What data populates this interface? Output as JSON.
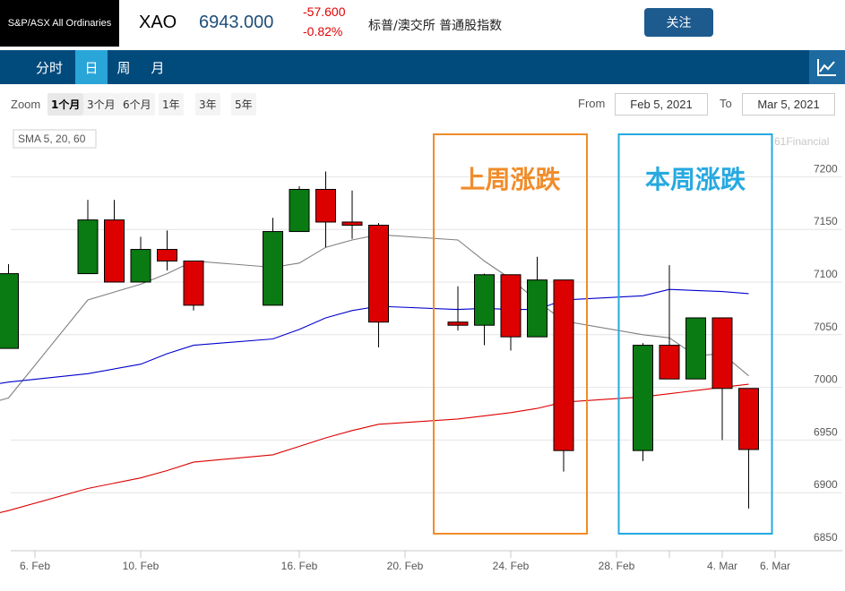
{
  "header": {
    "index_name": "S&P/ASX All Ordinaries",
    "symbol": "XAO",
    "price": "6943.000",
    "change_abs": "-57.600",
    "change_pct": "-0.82%",
    "description": "标普/澳交所 普通股指数",
    "follow_label": "关注"
  },
  "toolbar": {
    "tabs": [
      {
        "label": "分时",
        "active": false
      },
      {
        "label": "日",
        "active": true
      },
      {
        "label": "周",
        "active": false
      },
      {
        "label": "月",
        "active": false
      }
    ],
    "chart_icon": "line-chart-icon"
  },
  "controls": {
    "zoom_label": "Zoom",
    "zoom_options": [
      {
        "label": "1个月",
        "active": true
      },
      {
        "label": "3个月",
        "active": false
      },
      {
        "label": "6个月",
        "active": false
      },
      {
        "label": "1年",
        "active": false
      },
      {
        "label": "3年",
        "active": false
      },
      {
        "label": "5年",
        "active": false
      }
    ],
    "from_label": "From",
    "from_value": "Feb 5, 2021",
    "to_label": "To",
    "to_value": "Mar 5, 2021"
  },
  "chart_data": {
    "type": "candlestick",
    "indicator_label": "SMA 5, 20, 60",
    "watermark": "61Financial",
    "ylim": [
      6850,
      7225
    ],
    "y_ticks": [
      6850,
      6900,
      6950,
      7000,
      7050,
      7100,
      7150,
      7200
    ],
    "x_ticks": [
      {
        "date": "2021-02-06",
        "label": "6. Feb"
      },
      {
        "date": "2021-02-10",
        "label": "10. Feb"
      },
      {
        "date": "2021-02-16",
        "label": "16. Feb"
      },
      {
        "date": "2021-02-20",
        "label": "20. Feb"
      },
      {
        "date": "2021-02-24",
        "label": "24. Feb"
      },
      {
        "date": "2021-02-28",
        "label": "28. Feb"
      },
      {
        "date": "2021-03-02",
        "label": ""
      },
      {
        "date": "2021-03-04",
        "label": "4. Mar"
      },
      {
        "date": "2021-03-06",
        "label": "6. Mar"
      }
    ],
    "candles": [
      {
        "date": "2021-02-05",
        "open": 7037,
        "high": 7117,
        "low": 7037,
        "close": 7108
      },
      {
        "date": "2021-02-08",
        "open": 7108,
        "high": 7178,
        "low": 7108,
        "close": 7159
      },
      {
        "date": "2021-02-09",
        "open": 7159,
        "high": 7178,
        "low": 7100,
        "close": 7100
      },
      {
        "date": "2021-02-10",
        "open": 7100,
        "high": 7143,
        "low": 7100,
        "close": 7131
      },
      {
        "date": "2021-02-11",
        "open": 7131,
        "high": 7149,
        "low": 7111,
        "close": 7120
      },
      {
        "date": "2021-02-12",
        "open": 7120,
        "high": 7120,
        "low": 7073,
        "close": 7078
      },
      {
        "date": "2021-02-15",
        "open": 7078,
        "high": 7161,
        "low": 7078,
        "close": 7148
      },
      {
        "date": "2021-02-16",
        "open": 7148,
        "high": 7191,
        "low": 7148,
        "close": 7188
      },
      {
        "date": "2021-02-17",
        "open": 7188,
        "high": 7205,
        "low": 7133,
        "close": 7157
      },
      {
        "date": "2021-02-18",
        "open": 7157,
        "high": 7187,
        "low": 7141,
        "close": 7154
      },
      {
        "date": "2021-02-19",
        "open": 7154,
        "high": 7156,
        "low": 7038,
        "close": 7062
      },
      {
        "date": "2021-02-22",
        "open": 7062,
        "high": 7096,
        "low": 7054,
        "close": 7059
      },
      {
        "date": "2021-02-23",
        "open": 7059,
        "high": 7108,
        "low": 7040,
        "close": 7107
      },
      {
        "date": "2021-02-24",
        "open": 7107,
        "high": 7107,
        "low": 7035,
        "close": 7048
      },
      {
        "date": "2021-02-25",
        "open": 7048,
        "high": 7124,
        "low": 7048,
        "close": 7102
      },
      {
        "date": "2021-02-26",
        "open": 7102,
        "high": 7102,
        "low": 6920,
        "close": 6940
      },
      {
        "date": "2021-03-01",
        "open": 6940,
        "high": 7042,
        "low": 6930,
        "close": 7040
      },
      {
        "date": "2021-03-02",
        "open": 7040,
        "high": 7116,
        "low": 7008,
        "close": 7008
      },
      {
        "date": "2021-03-03",
        "open": 7008,
        "high": 7066,
        "low": 7008,
        "close": 7066
      },
      {
        "date": "2021-03-04",
        "open": 7066,
        "high": 7066,
        "low": 6950,
        "close": 6999
      },
      {
        "date": "2021-03-05",
        "open": 6999,
        "high": 6999,
        "low": 6885,
        "close": 6941
      }
    ],
    "series": [
      {
        "color": "#808080",
        "points": [
          [
            "2021-02-04",
            6983
          ],
          [
            "2021-02-05",
            6990
          ],
          [
            "2021-02-08",
            7083
          ],
          [
            "2021-02-10",
            7098
          ],
          [
            "2021-02-11",
            7108
          ],
          [
            "2021-02-12",
            7120
          ],
          [
            "2021-02-15",
            7114
          ],
          [
            "2021-02-16",
            7118
          ],
          [
            "2021-02-17",
            7133
          ],
          [
            "2021-02-18",
            7140
          ],
          [
            "2021-02-19",
            7145
          ],
          [
            "2021-02-22",
            7140
          ],
          [
            "2021-02-23",
            7120
          ],
          [
            "2021-02-24",
            7103
          ],
          [
            "2021-02-25",
            7082
          ],
          [
            "2021-02-26",
            7063
          ],
          [
            "2021-03-01",
            7050
          ],
          [
            "2021-03-02",
            7047
          ],
          [
            "2021-03-03",
            7030
          ],
          [
            "2021-03-04",
            7032
          ],
          [
            "2021-03-05",
            7011
          ]
        ]
      },
      {
        "color": "#0000cc",
        "points": [
          [
            "2021-02-04",
            7001
          ],
          [
            "2021-02-05",
            7005
          ],
          [
            "2021-02-08",
            7013
          ],
          [
            "2021-02-10",
            7022
          ],
          [
            "2021-02-11",
            7032
          ],
          [
            "2021-02-12",
            7040
          ],
          [
            "2021-02-15",
            7046
          ],
          [
            "2021-02-16",
            7055
          ],
          [
            "2021-02-17",
            7066
          ],
          [
            "2021-02-18",
            7073
          ],
          [
            "2021-02-19",
            7077
          ],
          [
            "2021-02-22",
            7074
          ],
          [
            "2021-02-23",
            7075
          ],
          [
            "2021-02-24",
            7074
          ],
          [
            "2021-02-25",
            7074
          ],
          [
            "2021-02-26",
            7083
          ],
          [
            "2021-03-01",
            7087
          ],
          [
            "2021-03-02",
            7093
          ],
          [
            "2021-03-03",
            7092
          ],
          [
            "2021-03-04",
            7091
          ],
          [
            "2021-03-05",
            7089
          ]
        ]
      },
      {
        "color": "#dd0000",
        "points": [
          [
            "2021-02-04",
            6877
          ],
          [
            "2021-02-05",
            6883
          ],
          [
            "2021-02-08",
            6904
          ],
          [
            "2021-02-10",
            6914
          ],
          [
            "2021-02-11",
            6921
          ],
          [
            "2021-02-12",
            6929
          ],
          [
            "2021-02-15",
            6936
          ],
          [
            "2021-02-16",
            6944
          ],
          [
            "2021-02-17",
            6952
          ],
          [
            "2021-02-18",
            6959
          ],
          [
            "2021-02-19",
            6965
          ],
          [
            "2021-02-22",
            6970
          ],
          [
            "2021-02-23",
            6973
          ],
          [
            "2021-02-24",
            6976
          ],
          [
            "2021-02-25",
            6980
          ],
          [
            "2021-02-26",
            6986
          ],
          [
            "2021-03-01",
            6991
          ],
          [
            "2021-03-02",
            6994
          ],
          [
            "2021-03-03",
            6997
          ],
          [
            "2021-03-04",
            7000
          ],
          [
            "2021-03-05",
            7003
          ]
        ]
      }
    ],
    "annotations": [
      {
        "label": "上周涨跌",
        "color": "#f08c2a",
        "from": "2021-02-22",
        "to": "2021-02-26"
      },
      {
        "label": "本周涨跌",
        "color": "#26a9e0",
        "from": "2021-03-01",
        "to": "2021-03-05"
      }
    ],
    "up_color": "#0a7a12",
    "down_color": "#dd0000"
  }
}
